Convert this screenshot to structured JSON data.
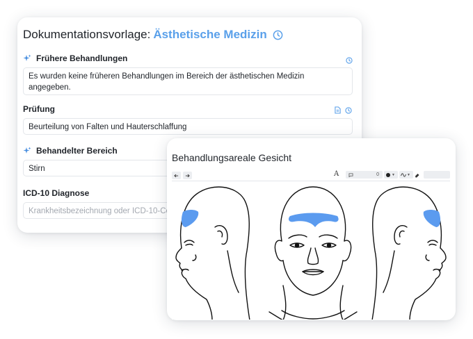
{
  "doc": {
    "title_prefix": "Dokumentationsvorlage:",
    "title_accent": "Ästhetische Medizin",
    "sections": [
      {
        "label": "Frühere Behandlungen",
        "value": "Es wurden keine früheren Behandlungen im Bereich der ästhetischen Medizin angegeben."
      },
      {
        "label": "Prüfung",
        "value": "Beurteilung von Falten und Hauterschlaffung"
      },
      {
        "label": "Behandelter Bereich",
        "value": "Stirn"
      },
      {
        "label": "ICD-10 Diagnose",
        "placeholder": "Krankheitsbezeichnung oder ICD-10-Code"
      }
    ]
  },
  "drawing": {
    "title": "Behandlungsareale Gesicht",
    "toolbar": {
      "undo_icon": "arrow-left-icon",
      "redo_icon": "arrow-right-icon",
      "text_tool": "A",
      "comment_count": "0"
    },
    "highlight_color": "#5b9bef"
  },
  "colors": {
    "accent": "#5aa0ea"
  }
}
